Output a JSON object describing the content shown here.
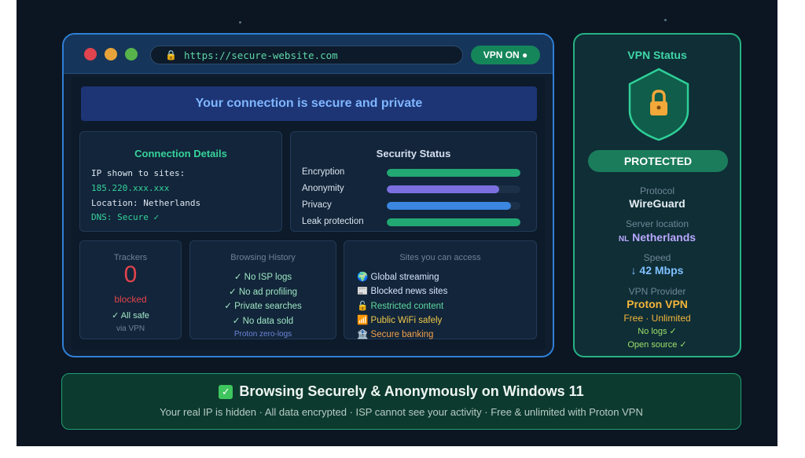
{
  "browser": {
    "url": "https://secure-website.com",
    "vpn_badge": "VPN ON ●",
    "banner": "Your connection is secure and private"
  },
  "connection": {
    "title": "Connection Details",
    "ip_label": "IP shown to sites:",
    "ip_value": "185.220.xxx.xxx",
    "location": "Location: Netherlands",
    "dns": "DNS: Secure ✓"
  },
  "security": {
    "title": "Security Status",
    "bars": [
      {
        "label": "Encryption",
        "level": 1.0,
        "color": "#22a872"
      },
      {
        "label": "Anonymity",
        "level": 0.84,
        "color": "#7b6fe0"
      },
      {
        "label": "Privacy",
        "level": 0.93,
        "color": "#3a86e0"
      },
      {
        "label": "Leak protection",
        "level": 1.0,
        "color": "#22a872"
      }
    ]
  },
  "trackers": {
    "title": "Trackers",
    "count": "0",
    "status": "blocked",
    "safe": "✓ All safe",
    "via": "via VPN"
  },
  "history": {
    "title": "Browsing History",
    "items": [
      "✓ No ISP logs",
      "✓ No ad profiling",
      "✓ Private searches",
      "✓ No data sold"
    ],
    "footer": "Proton zero-logs"
  },
  "sites": {
    "title": "Sites you can access",
    "items": [
      {
        "icon": "🌍",
        "label": "Global streaming",
        "color": "#d6e6ff",
        "icon_name": "globe-icon"
      },
      {
        "icon": "📰",
        "label": "Blocked news sites",
        "color": "#d6e6ff",
        "icon_name": "newspaper-icon"
      },
      {
        "icon": "🔓",
        "label": "Restricted content",
        "color": "#5fd99f",
        "icon_name": "unlock-icon"
      },
      {
        "icon": "📶",
        "label": "Public WiFi safely",
        "color": "#f0c94a",
        "icon_name": "wifi-icon"
      },
      {
        "icon": "🏦",
        "label": "Secure banking",
        "color": "#f2a14a",
        "icon_name": "bank-icon"
      }
    ]
  },
  "status": {
    "title": "VPN Status",
    "badge": "PROTECTED",
    "protocol_label": "Protocol",
    "protocol": "WireGuard",
    "server_label": "Server location",
    "server_flag": "NL",
    "server": "Netherlands",
    "speed_label": "Speed",
    "speed": "↓ 42 Mbps",
    "provider_label": "VPN Provider",
    "provider": "Proton VPN",
    "plan": "Free · Unlimited",
    "logs": "No logs ✓",
    "source": "Open source ✓"
  },
  "footer": {
    "headline": "Browsing Securely & Anonymously on Windows 11",
    "subline": "Your real IP is hidden · All data encrypted · ISP cannot see your activity · Free & unlimited with Proton VPN"
  }
}
